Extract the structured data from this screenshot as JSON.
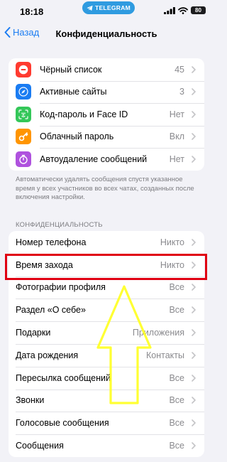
{
  "status": {
    "time": "18:18",
    "telegram_pill": "TELEGRAM",
    "battery": "80"
  },
  "nav": {
    "back_label": "Назад",
    "title": "Конфиденциальность"
  },
  "top_group": [
    {
      "label": "Чёрный список",
      "value": "45",
      "icon_color": "#ff3b30",
      "icon": "minus-circle-icon"
    },
    {
      "label": "Активные сайты",
      "value": "3",
      "icon_color": "#1a7cf2",
      "icon": "compass-icon"
    },
    {
      "label": "Код-пароль и Face ID",
      "value": "Нет",
      "icon_color": "#34c759",
      "icon": "face-id-icon"
    },
    {
      "label": "Облачный пароль",
      "value": "Вкл",
      "icon_color": "#ff9500",
      "icon": "key-icon"
    },
    {
      "label": "Автоудаление сообщений",
      "value": "Нет",
      "icon_color": "#af52de",
      "icon": "timer-icon"
    }
  ],
  "footnote": "Автоматически удалять сообщения спустя указанное время у всех участников во всех чатах, созданных после включения настройки.",
  "privacy_header": "КОНФИДЕНЦИАЛЬНОСТЬ",
  "privacy_group": [
    {
      "label": "Номер телефона",
      "value": "Никто"
    },
    {
      "label": "Время захода",
      "value": "Никто"
    },
    {
      "label": "Фотографии профиля",
      "value": "Все"
    },
    {
      "label": "Раздел «О себе»",
      "value": "Все"
    },
    {
      "label": "Подарки",
      "value": "Приложения"
    },
    {
      "label": "Дата рождения",
      "value": "Контакты"
    },
    {
      "label": "Пересылка сообщений",
      "value": "Все"
    },
    {
      "label": "Звонки",
      "value": "Все"
    },
    {
      "label": "Голосовые сообщения",
      "value": "Все"
    },
    {
      "label": "Сообщения",
      "value": "Все"
    }
  ],
  "annotations": {
    "highlight_color": "#e00012",
    "arrow_color": "#ffff33"
  }
}
